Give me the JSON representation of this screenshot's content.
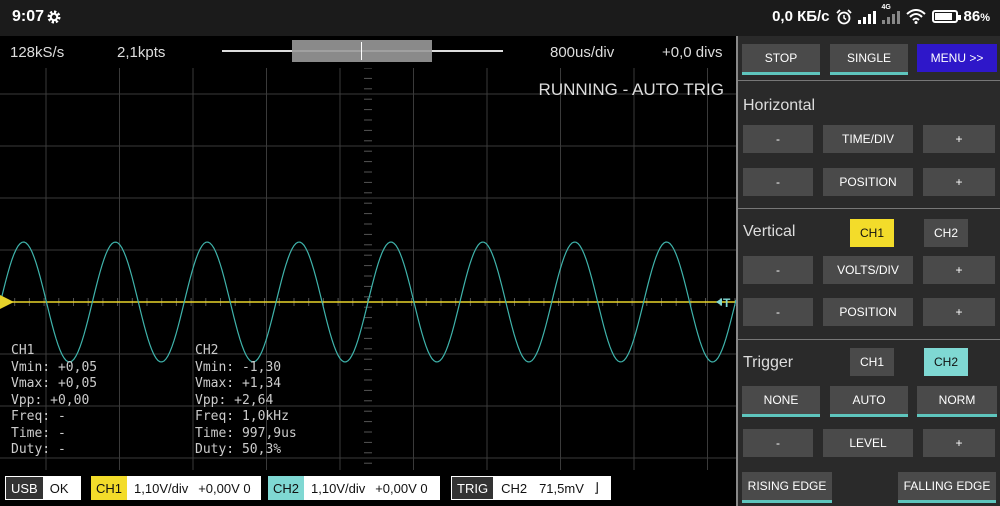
{
  "status_bar": {
    "time": "9:07",
    "net_speed": "0,0 КБ/с",
    "network_type": "4G",
    "battery": "86",
    "battery_level": 0.86,
    "icons": [
      "gear-icon",
      "alarm-icon",
      "signal-icon",
      "signal-4g-icon",
      "wifi-icon",
      "battery-icon"
    ]
  },
  "scope": {
    "sample_rate": "128kS/s",
    "points": "2,1kpts",
    "time_div": "800us/div",
    "position_divs": "+0,0 divs",
    "run_status": "RUNNING - AUTO TRIG",
    "trigger_marker": "T",
    "colors": {
      "ch1": "#e8d42a",
      "ch2": "#3fb3ab",
      "grid": "#3a3a3a"
    }
  },
  "measurements": {
    "ch1": {
      "title": "CH1",
      "lines": [
        "Vmin: +0,05",
        "Vmax: +0,05",
        "Vpp: +0,00",
        "Freq: -",
        "Time: -",
        "Duty: -"
      ]
    },
    "ch2": {
      "title": "CH2",
      "lines": [
        "Vmin: -1,30",
        "Vmax: +1,34",
        "Vpp: +2,64",
        "Freq: 1,0kHz",
        "Time: 997,9us",
        "Duty: 50,3%"
      ]
    }
  },
  "bottom_bar": {
    "usb": {
      "tag": "USB",
      "value": "OK"
    },
    "ch1": {
      "tag": "CH1",
      "vdiv": "1,10V/div",
      "offset": "+0,00V 0"
    },
    "ch2": {
      "tag": "CH2",
      "vdiv": "1,10V/div",
      "offset": "+0,00V 0"
    },
    "trig": {
      "tag": "TRIG",
      "source": "CH2",
      "level": "71,5mV",
      "edge_symbol": "⌋"
    }
  },
  "panel": {
    "stop": "STOP",
    "single": "SINGLE",
    "menu": "MENU >>",
    "horizontal": {
      "title": "Horizontal",
      "minus": "-",
      "plus": "+",
      "time_div": "TIME/DIV",
      "position": "POSITION"
    },
    "vertical": {
      "title": "Vertical",
      "ch1": "CH1",
      "ch2": "CH2",
      "minus": "-",
      "plus": "+",
      "volts_div": "VOLTS/DIV",
      "position": "POSITION"
    },
    "trigger": {
      "title": "Trigger",
      "ch1": "CH1",
      "ch2": "CH2",
      "none": "NONE",
      "auto": "AUTO",
      "norm": "NORM",
      "minus": "-",
      "plus": "+",
      "level": "LEVEL",
      "rising": "RISING EDGE",
      "falling": "FALLING EDGE"
    }
  }
}
